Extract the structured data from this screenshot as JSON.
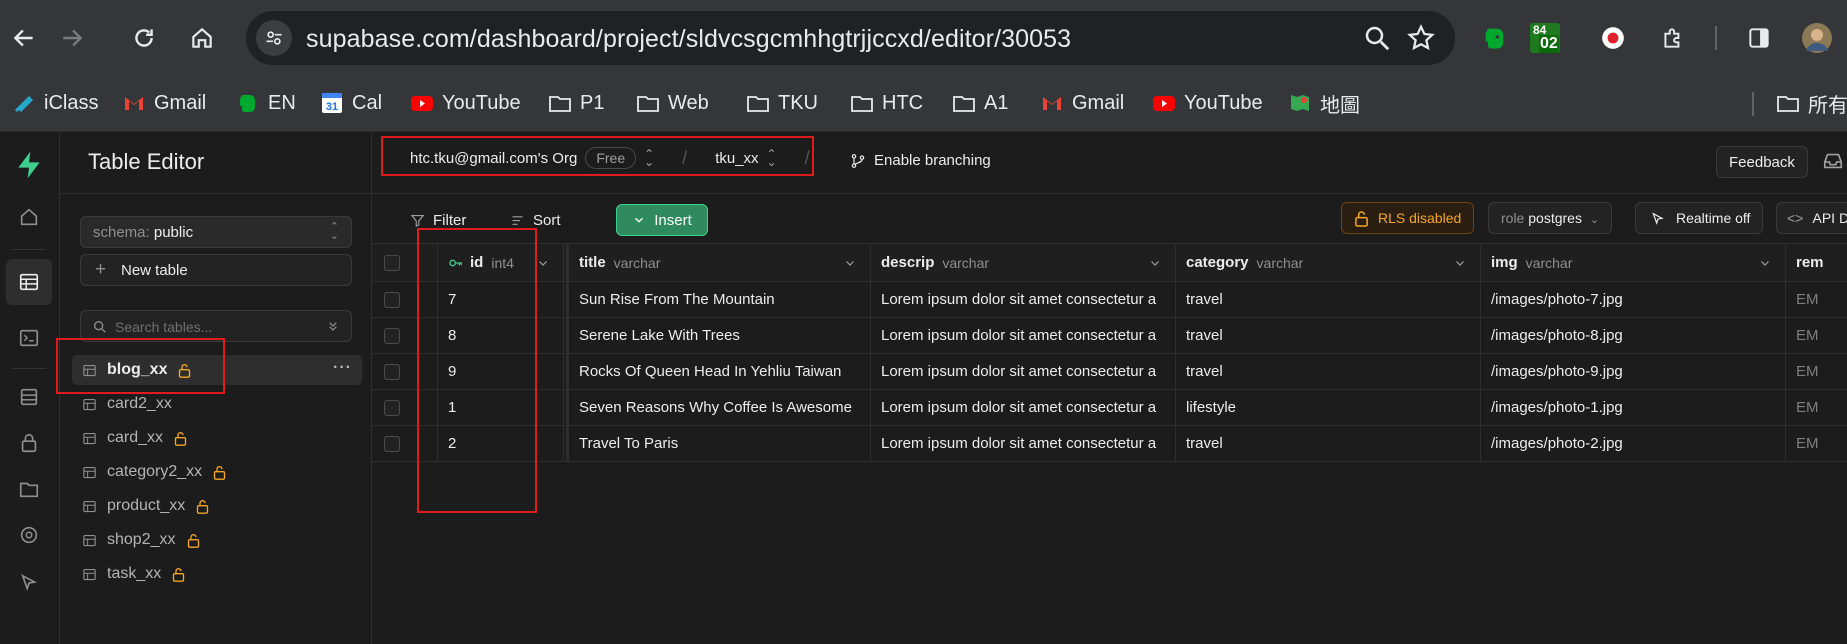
{
  "browser": {
    "url": "supabase.com/dashboard/project/sldvcsgcmhhgtrjjccxd/editor/30053",
    "extension_badge_top": "84",
    "extension_badge_bottom": "02",
    "bookmarks": [
      {
        "label": "iClass",
        "icon": "iclass-icon"
      },
      {
        "label": "Gmail",
        "icon": "gmail-icon"
      },
      {
        "label": "EN",
        "icon": "evernote-icon"
      },
      {
        "label": "Cal",
        "icon": "calendar-icon"
      },
      {
        "label": "YouTube",
        "icon": "youtube-icon"
      },
      {
        "label": "P1",
        "icon": "folder-icon"
      },
      {
        "label": "Web",
        "icon": "folder-icon"
      },
      {
        "label": "TKU",
        "icon": "folder-icon"
      },
      {
        "label": "HTC",
        "icon": "folder-icon"
      },
      {
        "label": "A1",
        "icon": "folder-icon"
      },
      {
        "label": "Gmail",
        "icon": "gmail-icon"
      },
      {
        "label": "YouTube",
        "icon": "youtube-icon"
      },
      {
        "label": "地圖",
        "icon": "maps-icon"
      }
    ],
    "bookmarks_overflow": "所有",
    "calendar_day": "31"
  },
  "sidebar": {
    "title": "Table Editor",
    "schema_label": "schema:",
    "schema_value": "public",
    "new_table_label": "New table",
    "search_placeholder": "Search tables...",
    "tables": [
      {
        "name": "blog_xx",
        "locked": true
      },
      {
        "name": "card2_xx",
        "locked": false
      },
      {
        "name": "card_xx",
        "locked": true
      },
      {
        "name": "category2_xx",
        "locked": true
      },
      {
        "name": "product_xx",
        "locked": true
      },
      {
        "name": "shop2_xx",
        "locked": true
      },
      {
        "name": "task_xx",
        "locked": true
      }
    ],
    "more_label": "···"
  },
  "header": {
    "org": "htc.tku@gmail.com's Org",
    "plan": "Free",
    "project": "tku_xx",
    "branching_label": "Enable branching",
    "feedback_label": "Feedback"
  },
  "toolbar": {
    "filter_label": "Filter",
    "sort_label": "Sort",
    "insert_label": "Insert",
    "rls_label": "RLS disabled",
    "role_prefix": "role",
    "role_value": "postgres",
    "realtime_label": "Realtime off",
    "api_label": "API D"
  },
  "table": {
    "columns": [
      {
        "name": "id",
        "type": "int4"
      },
      {
        "name": "title",
        "type": "varchar"
      },
      {
        "name": "descrip",
        "type": "varchar"
      },
      {
        "name": "category",
        "type": "varchar"
      },
      {
        "name": "img",
        "type": "varchar"
      },
      {
        "name": "rem",
        "type": ""
      }
    ],
    "rows": [
      {
        "id": "7",
        "title": "Sun Rise From The Mountain",
        "descrip": "Lorem ipsum dolor sit amet consectetur a",
        "category": "travel",
        "img": "/images/photo-7.jpg",
        "rem": "EM"
      },
      {
        "id": "8",
        "title": "Serene Lake With Trees",
        "descrip": "Lorem ipsum dolor sit amet consectetur a",
        "category": "travel",
        "img": "/images/photo-8.jpg",
        "rem": "EM"
      },
      {
        "id": "9",
        "title": "Rocks Of Queen Head In Yehliu Taiwan",
        "descrip": "Lorem ipsum dolor sit amet consectetur a",
        "category": "travel",
        "img": "/images/photo-9.jpg",
        "rem": "EM"
      },
      {
        "id": "1",
        "title": "Seven Reasons Why Coffee Is Awesome",
        "descrip": "Lorem ipsum dolor sit amet consectetur a",
        "category": "lifestyle",
        "img": "/images/photo-1.jpg",
        "rem": "EM"
      },
      {
        "id": "2",
        "title": "Travel To Paris",
        "descrip": "Lorem ipsum dolor sit amet consectetur a",
        "category": "travel",
        "img": "/images/photo-2.jpg",
        "rem": "EM"
      }
    ]
  },
  "colors": {
    "brand": "#3ecf8e",
    "highlight": "#e01b1b",
    "rls_warning": "#f5a623"
  }
}
